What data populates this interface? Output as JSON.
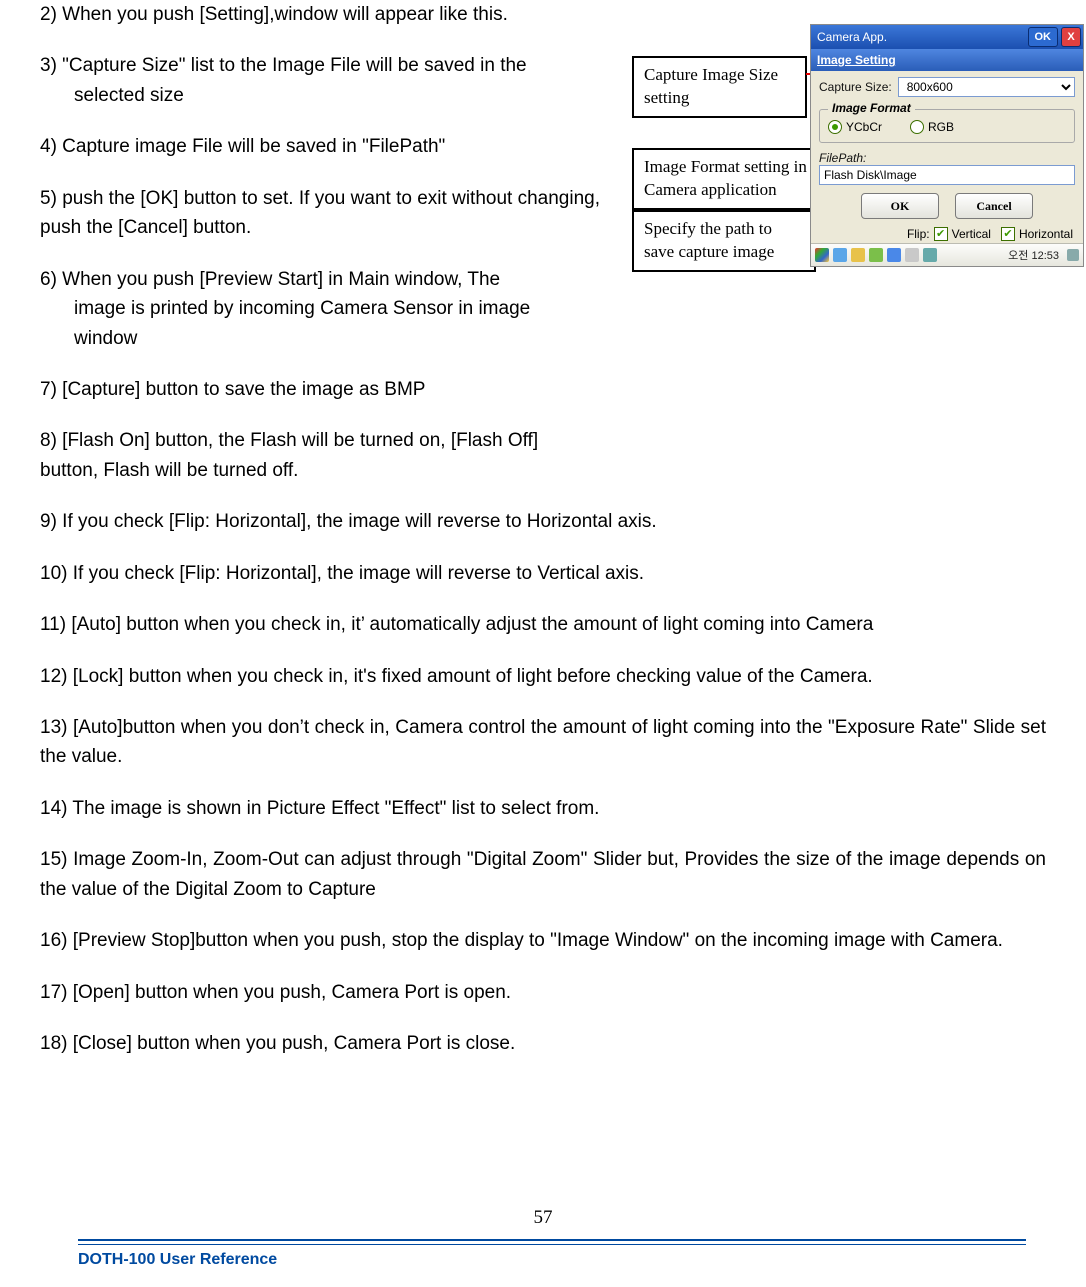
{
  "paragraphs": {
    "p2": "2) When you push [Setting],window will appear like this.",
    "p3a": "3) \"Capture Size\" list to the Image File will be saved in the",
    "p3b": "selected size",
    "p4": "4) Capture image File will be saved in \"FilePath\"",
    "p5": "5) push the [OK] button to set. If you want to exit without changing, push the [Cancel] button.",
    "p6a": "6) When you push [Preview Start] in Main window, The",
    "p6b": "image is printed by incoming Camera Sensor in image",
    "p6c": "window",
    "p7": "7) [Capture] button to save the image as BMP",
    "p8": "8) [Flash On] button, the Flash will be turned on, [Flash Off] button, Flash will be turned off.",
    "p9": "9) If you check [Flip: Horizontal], the image will reverse to Horizontal axis.",
    "p10": "10) If you check [Flip: Horizontal], the image will reverse to Vertical axis.",
    "p11": "11) [Auto] button when you check in, it’  automatically adjust the amount of light coming into Camera",
    "p12": "12) [Lock] button when you check in, it's fixed amount of light before checking value of the Camera.",
    "p13": "13) [Auto]button when you don’t check in, Camera control the amount of light coming into the \"Exposure Rate\" Slide set the value.",
    "p14": "14) The image is shown in Picture Effect \"Effect\" list to select from.",
    "p15": "15) Image Zoom-In, Zoom-Out can adjust through \"Digital Zoom\" Slider but, Provides the size of the image depends on the value of the Digital Zoom to Capture",
    "p16": "16) [Preview Stop]button when you push, stop the display to \"Image Window\" on the incoming image with Camera.",
    "p17": "17) [Open] button when you push, Camera Port is open.",
    "p18": "18) [Close] button when you push, Camera Port is close."
  },
  "callouts": {
    "c1": "Capture Image Size setting",
    "c2": "Image Format setting in Camera application",
    "c3": "Specify the path to save capture image"
  },
  "screenshot": {
    "title": "Camera App.",
    "title_ok": "OK",
    "title_x": "X",
    "menubar": "Image Setting",
    "capture_label": "Capture Size:",
    "capture_value": "800x600",
    "fieldset_legend": "Image Format",
    "radio_ycbcr": "YCbCr",
    "radio_rgb": "RGB",
    "filepath_label": "FilePath:",
    "filepath_value": "Flash Disk\\Image",
    "btn_ok": "OK",
    "btn_cancel": "Cancel",
    "flip_label": "Flip:",
    "flip_v": "Vertical",
    "flip_h": "Horizontal",
    "clock": "오전 12:53"
  },
  "footer": {
    "page": "57",
    "ref": "DOTH-100 User Reference"
  }
}
